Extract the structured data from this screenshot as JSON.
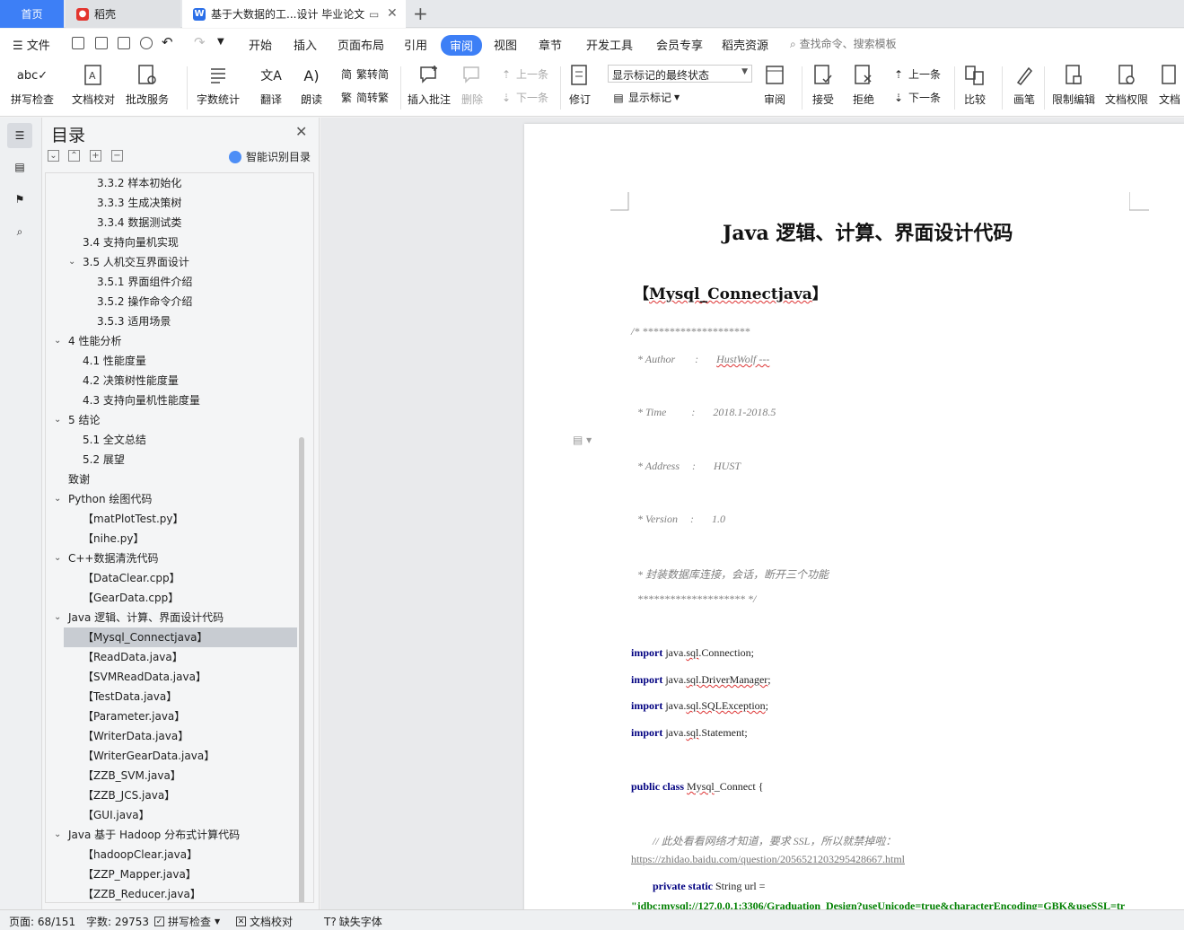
{
  "tabs": {
    "home": "首页",
    "daoke": "稻壳",
    "document": "基于大数据的工...设计 毕业论文"
  },
  "menu": {
    "file": "文件",
    "items": [
      "开始",
      "插入",
      "页面布局",
      "引用",
      "审阅",
      "视图",
      "章节",
      "开发工具",
      "会员专享",
      "稻壳资源"
    ],
    "active": "审阅",
    "search_placeholder": "查找命令、搜索模板"
  },
  "ribbon": {
    "spell_check": "拼写检查",
    "doc_proof": "文档校对",
    "review_service": "批改服务",
    "word_count": "字数统计",
    "translate": "翻译",
    "read_aloud": "朗读",
    "trad_to_simp": "繁转简",
    "simp_to_trad": "简转繁",
    "insert_comment": "插入批注",
    "delete": "删除",
    "prev_comment": "上一条",
    "next_comment": "下一条",
    "track_changes": "修订",
    "markup_mode": "显示标记的最终状态",
    "show_markup": "显示标记",
    "review": "审阅",
    "accept": "接受",
    "reject": "拒绝",
    "prev_change": "上一条",
    "next_change": "下一条",
    "compare": "比较",
    "pen": "画笔",
    "restrict_edit": "限制编辑",
    "doc_permission": "文档权限",
    "doc_cut": "文档"
  },
  "toc": {
    "title": "目录",
    "smart_label": "智能识别目录",
    "items": [
      {
        "text": "3.3.2  样本初始化",
        "level": 3,
        "chevron": false
      },
      {
        "text": "3.3.3  生成决策树",
        "level": 3,
        "chevron": false
      },
      {
        "text": "3.3.4  数据测试类",
        "level": 3,
        "chevron": false
      },
      {
        "text": "3.4  支持向量机实现",
        "level": 2,
        "chevron": false
      },
      {
        "text": "3.5  人机交互界面设计",
        "level": 2,
        "chevron": true
      },
      {
        "text": "3.5.1  界面组件介绍",
        "level": 3,
        "chevron": false
      },
      {
        "text": "3.5.2  操作命令介绍",
        "level": 3,
        "chevron": false
      },
      {
        "text": "3.5.3  适用场景",
        "level": 3,
        "chevron": false
      },
      {
        "text": "4  性能分析",
        "level": 1,
        "chevron": true
      },
      {
        "text": "4.1  性能度量",
        "level": 2,
        "chevron": false
      },
      {
        "text": "4.2  决策树性能度量",
        "level": 2,
        "chevron": false
      },
      {
        "text": "4.3  支持向量机性能度量",
        "level": 2,
        "chevron": false
      },
      {
        "text": "5  结论",
        "level": 1,
        "chevron": true
      },
      {
        "text": "5.1  全文总结",
        "level": 2,
        "chevron": false
      },
      {
        "text": "5.2  展望",
        "level": 2,
        "chevron": false
      },
      {
        "text": "致谢",
        "level": 1,
        "chevron": false
      },
      {
        "text": "Python 绘图代码",
        "level": 1,
        "chevron": true
      },
      {
        "text": "【matPlotTest.py】",
        "level": 2,
        "chevron": false
      },
      {
        "text": "【nihe.py】",
        "level": 2,
        "chevron": false
      },
      {
        "text": "C++数据清洗代码",
        "level": 1,
        "chevron": true
      },
      {
        "text": "【DataClear.cpp】",
        "level": 2,
        "chevron": false
      },
      {
        "text": "【GearData.cpp】",
        "level": 2,
        "chevron": false
      },
      {
        "text": "Java  逻辑、计算、界面设计代码",
        "level": 1,
        "chevron": true
      },
      {
        "text": "【Mysql_Connectjava】",
        "level": 2,
        "chevron": false,
        "selected": true
      },
      {
        "text": "【ReadData.java】",
        "level": 2,
        "chevron": false
      },
      {
        "text": "【SVMReadData.java】",
        "level": 2,
        "chevron": false
      },
      {
        "text": "【TestData.java】",
        "level": 2,
        "chevron": false
      },
      {
        "text": "【Parameter.java】",
        "level": 2,
        "chevron": false
      },
      {
        "text": "【WriterData.java】",
        "level": 2,
        "chevron": false
      },
      {
        "text": "【WriterGearData.java】",
        "level": 2,
        "chevron": false
      },
      {
        "text": "【ZZB_SVM.java】",
        "level": 2,
        "chevron": false
      },
      {
        "text": "【ZZB_JCS.java】",
        "level": 2,
        "chevron": false
      },
      {
        "text": "【GUI.java】",
        "level": 2,
        "chevron": false
      },
      {
        "text": "Java  基于 Hadoop 分布式计算代码",
        "level": 1,
        "chevron": true
      },
      {
        "text": "【hadoopClear.java】",
        "level": 2,
        "chevron": false
      },
      {
        "text": "【ZZP_Mapper.java】",
        "level": 2,
        "chevron": false
      },
      {
        "text": "【ZZB_Reducer.java】",
        "level": 2,
        "chevron": false
      }
    ]
  },
  "document": {
    "title": "Java  逻辑、计算、界面设计代码",
    "section_open": "【",
    "section_name": "Mysql_Connectjava",
    "section_close": "】",
    "comment_open": "/* ********************",
    "author_label": "* Author",
    "author_colon": ":",
    "author_value": "HustWolf ---",
    "time_label": "* Time",
    "time_colon": ":",
    "time_value": "2018.1-2018.5",
    "address_label": "* Address",
    "address_colon": ":",
    "address_value": "HUST",
    "version_label": "* Version",
    "version_colon": ":",
    "version_value": "1.0",
    "desc": "*  封装数据库连接，会话，断开三个功能",
    "comment_close": "******************** */",
    "kw_import": "import",
    "import1_a": "java.",
    "import1_b": "sql",
    "import1_c": ".Connection;",
    "import2_a": "java.",
    "import2_b": "sql.DriverManager",
    "import2_c": ";",
    "import3_a": "java.",
    "import3_b": "sql.SQLException",
    "import3_c": ";",
    "import4_a": "java.",
    "import4_b": "sql",
    "import4_c": ".Statement;",
    "kw_public_class": "public class",
    "class_name": "Mysql",
    "class_rest": "_Connect {",
    "line_comment": "// 此处看看网络才知道，要求 SSL，所以就禁掉啦：",
    "url_text": "https://zhidao.baidu.com/question/2056521203295428667.html",
    "kw_private_static": "private static",
    "field_decl": "String url =",
    "jdbc_string": "\"jdbc:mysql://127.0.0.1:3306/Graduation_Design?useUnicode=true&characterEncoding=GBK&useSSL=tr"
  },
  "status": {
    "page": "页面: 68/151",
    "words": "字数: 29753",
    "spell_check": "拼写检查",
    "doc_proof": "文档校对",
    "missing_font": "缺失字体"
  },
  "colors": {
    "accent": "#3d7ff6",
    "keyword": "#000080",
    "string": "#008000",
    "comment": "#808080"
  }
}
